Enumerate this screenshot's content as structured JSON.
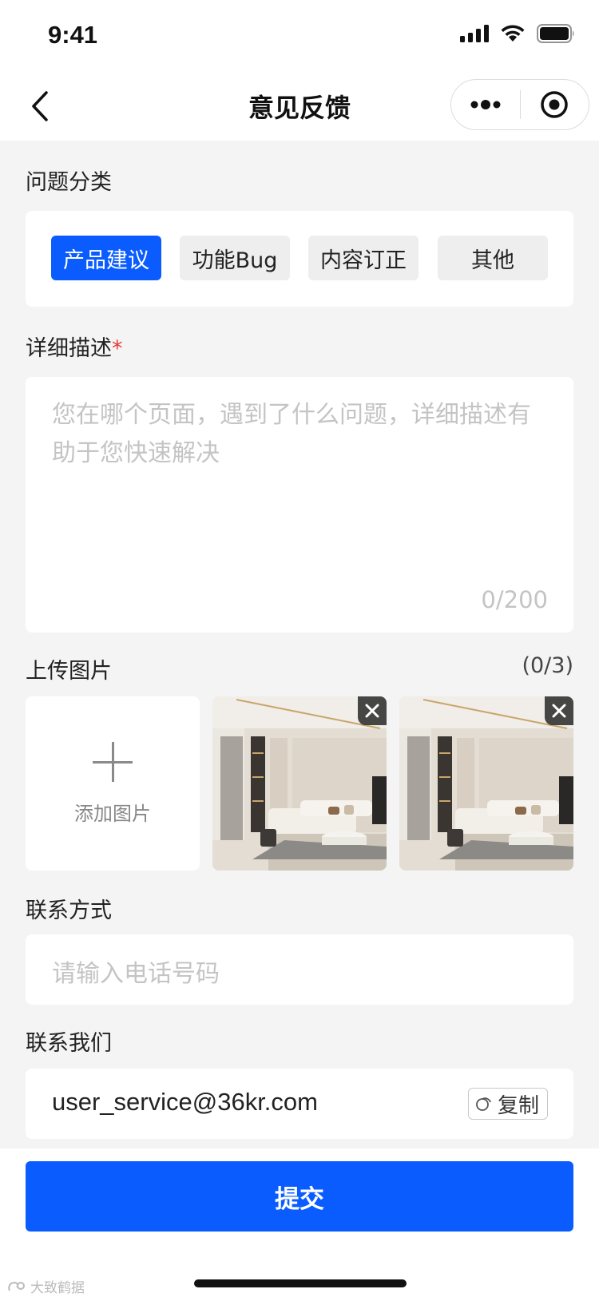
{
  "status_bar": {
    "time": "9:41"
  },
  "nav": {
    "title": "意见反馈"
  },
  "category": {
    "label": "问题分类",
    "options": [
      "产品建议",
      "功能Bug",
      "内容订正",
      "其他"
    ],
    "selected": "产品建议"
  },
  "description": {
    "label": "详细描述",
    "required_mark": "*",
    "placeholder": "您在哪个页面，遇到了什么问题，详细描述有助于您快速解决",
    "count": "0/200"
  },
  "upload": {
    "label": "上传图片",
    "count": "(0/3)",
    "add_label": "添加图片"
  },
  "contact": {
    "label": "联系方式",
    "placeholder": "请输入电话号码"
  },
  "contact_us": {
    "label": "联系我们",
    "email": "user_service@36kr.com",
    "copy_label": "复制"
  },
  "submit_label": "提交",
  "watermark": "大致鹤据",
  "colors": {
    "accent": "#0a5cff",
    "background": "#f4f4f4",
    "required": "#e53935",
    "placeholder": "#c4c4c4"
  }
}
